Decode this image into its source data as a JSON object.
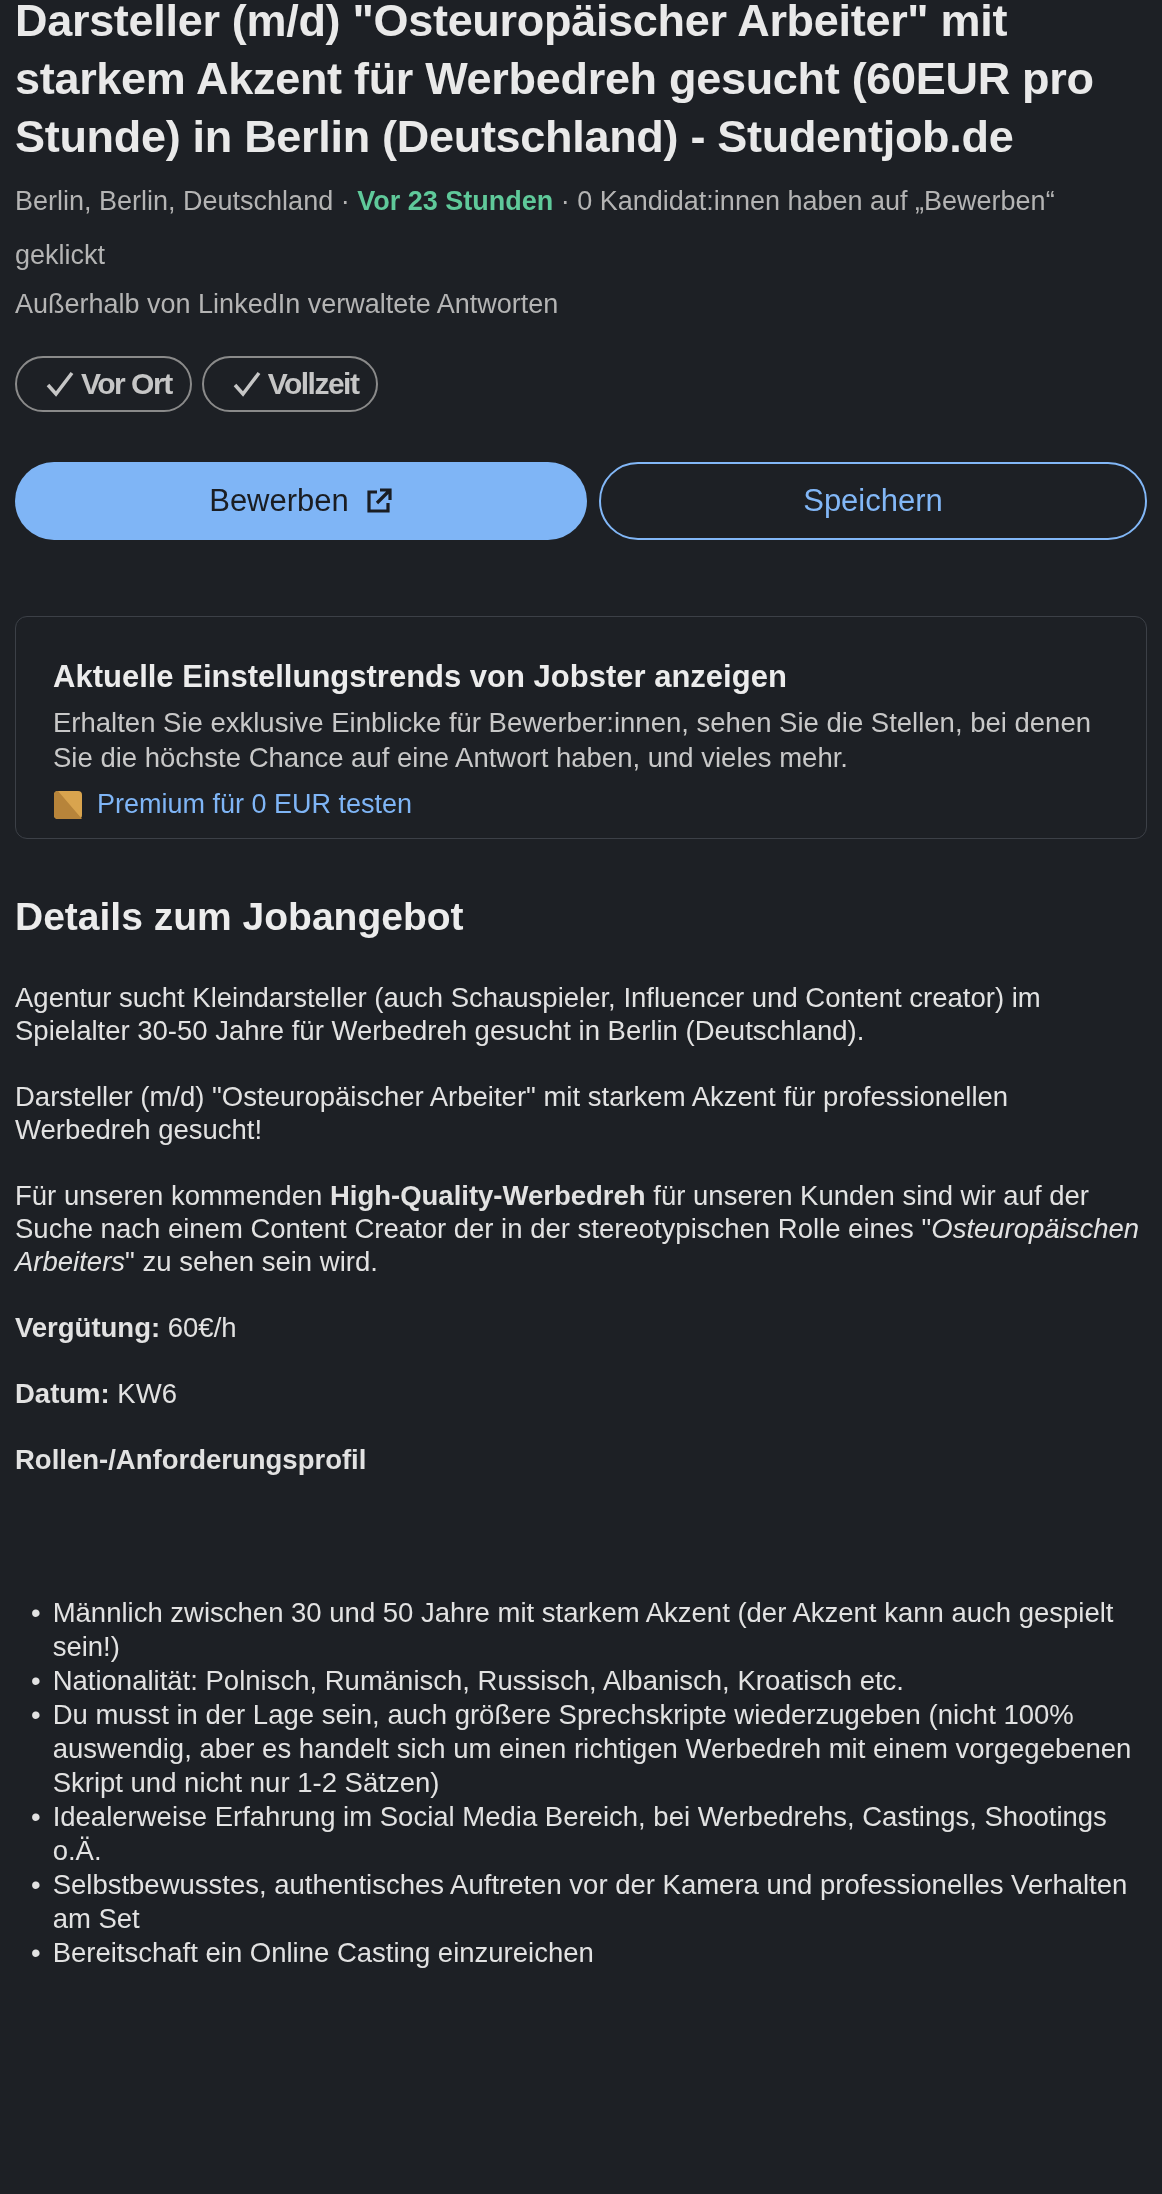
{
  "job": {
    "title": "Darsteller (m/d) \"Osteuropäischer Arbeiter\" mit starkem Akzent für Werbedreh gesucht (60EUR pro Stunde) in Berlin (Deutschland) - Studentjob.de",
    "meta": [
      {
        "text": "Berlin, Berlin, Deutschland",
        "highlight": false
      },
      {
        "text": "·",
        "highlight": false
      },
      {
        "text": "Vor 23 Stunden",
        "highlight": true
      },
      {
        "text": "·",
        "highlight": false
      },
      {
        "text": "0 Kandidat:innen haben auf „Bewerben“ geklickt",
        "highlight": false
      }
    ],
    "note": "Außerhalb von LinkedIn verwaltete Antworten",
    "chips": [
      {
        "label": "Vor Ort",
        "checked": true
      },
      {
        "label": "Vollzeit",
        "checked": true
      }
    ],
    "buttons": [
      {
        "label": "Bewerben",
        "kind": "primary"
      },
      {
        "label": "Speichern",
        "kind": "outline"
      }
    ]
  },
  "promo": {
    "title": "Aktuelle Einstellungstrends von Jobster anzeigen",
    "text": "Erhalten Sie exklusive Einblicke für Bewerber:innen, sehen Sie die Stellen, bei denen Sie die höchste Chance auf eine Antwort haben, und vieles mehr.",
    "link": "Premium für 0 EUR testen"
  },
  "details": {
    "heading": "Details zum Jobangebot",
    "paragraphs": [
      {
        "kind": "text",
        "text": "Agentur sucht Kleindarsteller (auch Schauspieler, Influencer und Content creator) im Spielalter 30-50 Jahre für Werbedreh gesucht in Berlin (Deutschland)."
      },
      {
        "kind": "text",
        "text": "Darsteller (m/d) \"Osteuropäischer Arbeiter\" mit starkem Akzent für professionellen Werbedreh gesucht!"
      },
      {
        "kind": "text",
        "text": "Für unseren kommenden **High-Quality-Werbedreh** für unseren Kunden sind wir auf der Suche nach einem Content Creator der in der stereotypischen Rolle eines \"*Osteuropäischen Arbeiters*\" zu sehen sein wird."
      },
      {
        "kind": "text",
        "text": "**Vergütung:** 60€/h"
      },
      {
        "kind": "text",
        "text": "**Datum:** KW6"
      },
      {
        "kind": "subheading",
        "text": "Rollen-/Anforderungsprofil"
      }
    ],
    "list": [
      {
        "bullet": "•",
        "text": "Männlich zwischen 30 und 50 Jahre mit starkem Akzent (der Akzent kann auch gespielt sein!)"
      },
      {
        "bullet": "•",
        "text": "Nationalität: Polnisch, Rumänisch, Russisch, Albanisch, Kroatisch etc."
      },
      {
        "bullet": "•",
        "text": "Du musst in der Lage sein, auch größere Sprechskripte wiederzugeben (nicht 100% auswendig, aber es handelt sich um einen richtigen Werbedreh mit einem vorgegebenen Skript und nicht nur 1-2 Sätzen)"
      },
      {
        "bullet": "•",
        "text": "Idealerweise Erfahrung im Social Media Bereich, bei Werbedrehs, Castings, Shootings o.Ä."
      },
      {
        "bullet": "•",
        "text": "Selbstbewusstes, authentisches Auftreten vor der Kamera und professionelles Verhalten am Set"
      },
      {
        "bullet": "•",
        "text": "Bereitschaft ein Online Casting einzureichen"
      }
    ]
  }
}
